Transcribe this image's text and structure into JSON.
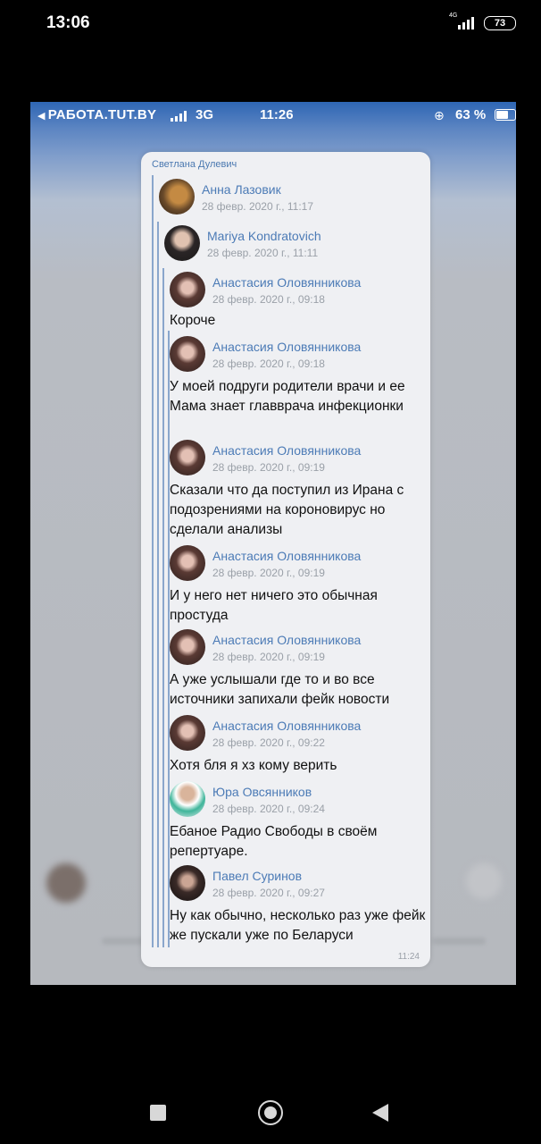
{
  "outer_status": {
    "time": "13:06",
    "network": "4G",
    "battery": "73"
  },
  "screenshot_status": {
    "carrier": "РАБОТА.TUT.BY",
    "network": "3G",
    "time": "11:26",
    "battery": "63 %"
  },
  "bubble": {
    "forwarded_from": "Светлана Дулевич",
    "time": "11:24",
    "messages": [
      {
        "name": "Анна Лазовик",
        "date": "28 февр. 2020 г., 11:17",
        "text": ""
      },
      {
        "name": "Mariya Kondratovich",
        "date": "28 февр. 2020 г., 11:11",
        "text": ""
      },
      {
        "name": "Анастасия Оловянникова",
        "date": "28 февр. 2020 г., 09:18",
        "text": "Короче"
      },
      {
        "name": "Анастасия Оловянникова",
        "date": "28 февр. 2020 г., 09:18",
        "text": "У моей подруги родители врачи и ее Мама знает главврача инфекционки"
      },
      {
        "name": "Анастасия Оловянникова",
        "date": "28 февр. 2020 г., 09:19",
        "text": "Сказали что да поступил из Ирана с подозрениями на короновирус но сделали анализы"
      },
      {
        "name": "Анастасия Оловянникова",
        "date": "28 февр. 2020 г., 09:19",
        "text": "И у него нет ничего это обычная простуда"
      },
      {
        "name": "Анастасия Оловянникова",
        "date": "28 февр. 2020 г., 09:19",
        "text": "А уже услышали где то и во все источники запихали фейк новости"
      },
      {
        "name": "Анастасия Оловянникова",
        "date": "28 февр. 2020 г., 09:22",
        "text": "Хотя бля я хз кому верить"
      },
      {
        "name": "Юра Овсянников",
        "date": "28 февр. 2020 г., 09:24",
        "text": "Ебаное Радио Свободы в своём репертуаре."
      },
      {
        "name": "Павел Суринов",
        "date": "28 февр. 2020 г., 09:27",
        "text": "Ну как обычно, несколько раз уже фейк же пускали уже по Беларуси"
      }
    ]
  },
  "colors": {
    "link": "#4c7bb6",
    "bubble": "#eff0f3",
    "header": "#2e66b4"
  }
}
